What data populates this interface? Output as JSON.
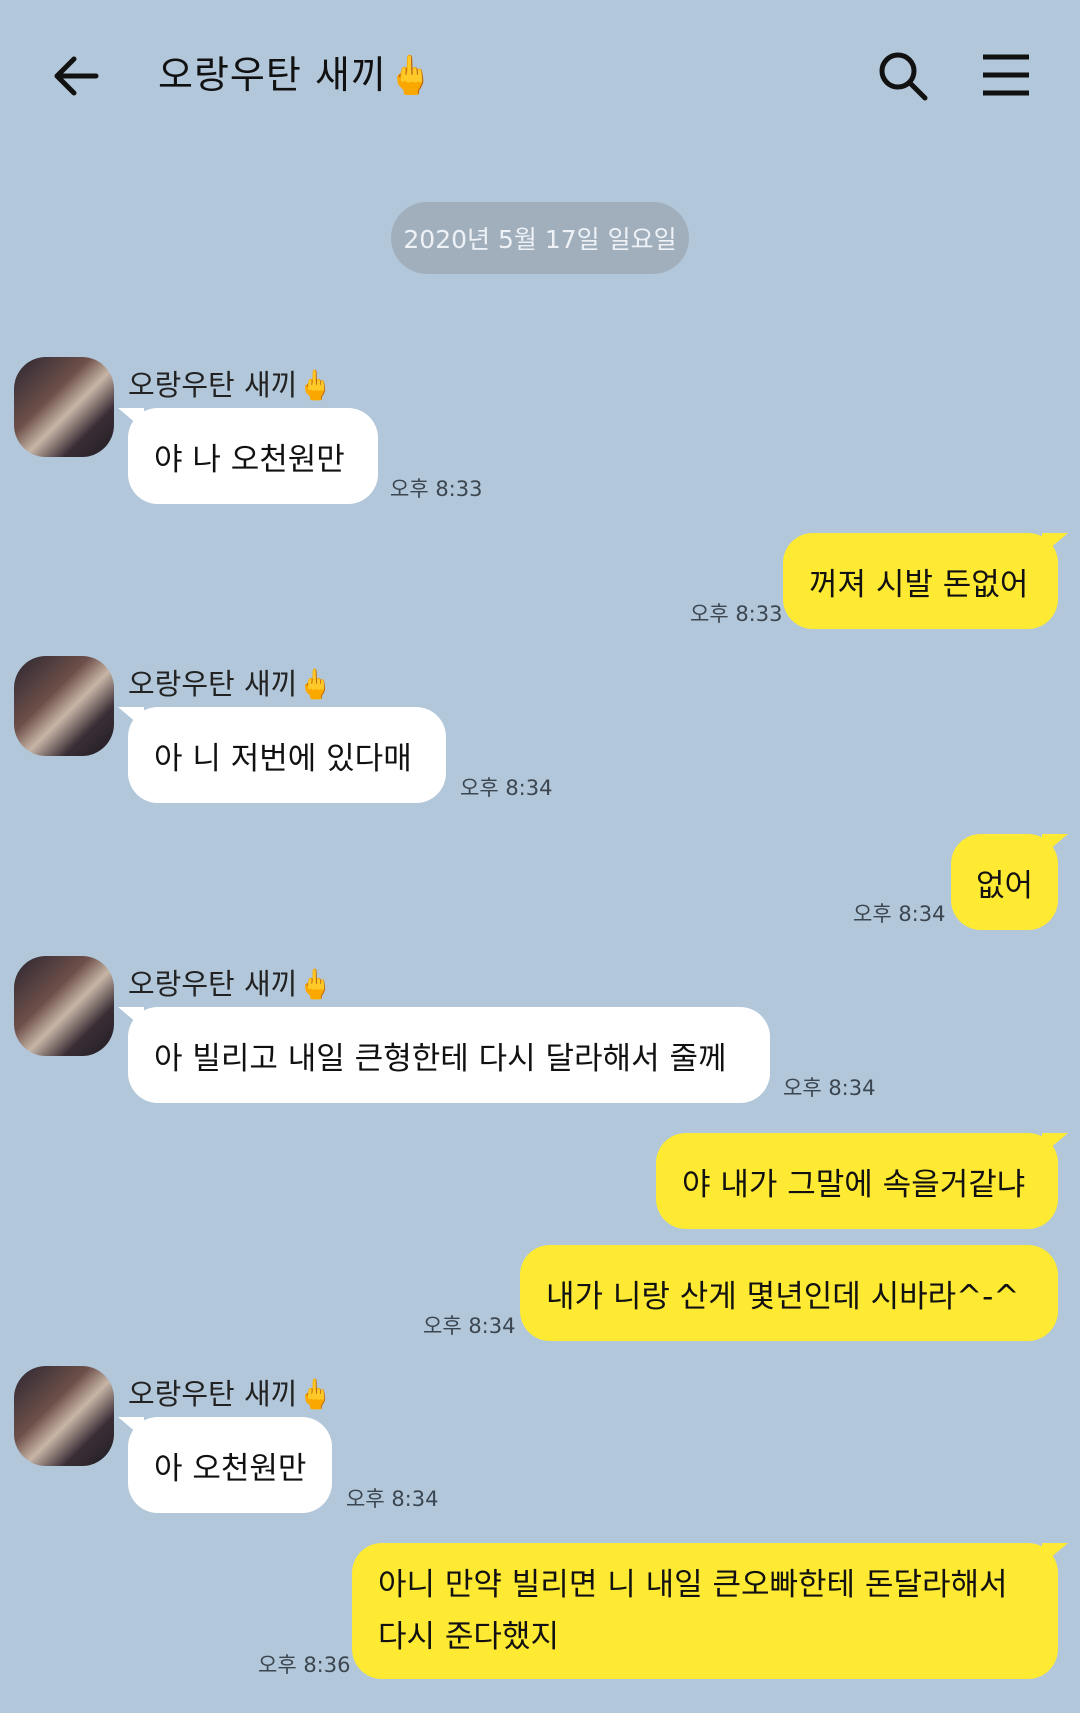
{
  "header": {
    "title": "오랑우탄 새끼🖕",
    "icons": {
      "back": "arrow-left-icon",
      "search": "search-icon",
      "menu": "hamburger-menu-icon"
    }
  },
  "date_divider": "2020년 5월 17일 일요일",
  "sender": {
    "name": "오랑우탄 새끼🖕"
  },
  "messages": [
    {
      "from": "other",
      "text": "야 나 오천원만",
      "time": "오후 8:33"
    },
    {
      "from": "me",
      "text": "꺼져 시발 돈없어",
      "time": "오후 8:33"
    },
    {
      "from": "other",
      "text": "아 니 저번에 있다매",
      "time": "오후 8:34"
    },
    {
      "from": "me",
      "text": "없어",
      "time": "오후 8:34"
    },
    {
      "from": "other",
      "text": "아 빌리고 내일 큰형한테 다시 달라해서 줄께",
      "time": "오후 8:34"
    },
    {
      "from": "me",
      "text": "야 내가 그말에 속을거같냐",
      "time": ""
    },
    {
      "from": "me",
      "text": "내가 니랑 산게 몇년인데 시바라^-^",
      "time": "오후 8:34"
    },
    {
      "from": "other",
      "text": "아 오천원만",
      "time": "오후 8:34"
    },
    {
      "from": "me",
      "lines": [
        "아니 만약 빌리면 니 내일 큰오빠한테 돈달라해서",
        "다시 준다했지"
      ],
      "time": "오후 8:36"
    }
  ],
  "colors": {
    "background": "#b2c7da",
    "my_bubble": "#fee933",
    "their_bubble": "#ffffff",
    "date_pill": "#a1afbd"
  }
}
